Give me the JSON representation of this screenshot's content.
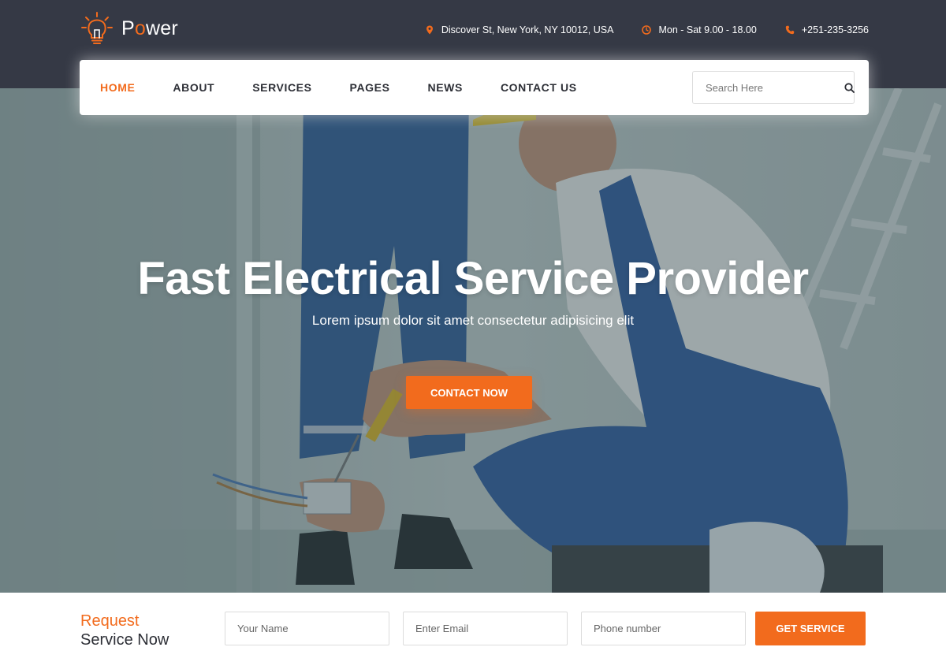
{
  "brand": {
    "logo_text_prefix": "P",
    "logo_text_accent": "o",
    "logo_text_suffix": "wer",
    "icon": "lightbulb-icon",
    "accent_color": "#f26b1d",
    "topbar_color": "#353945"
  },
  "contact": {
    "address": "Discover St, New York, NY 10012, USA",
    "hours": "Mon - Sat 9.00 - 18.00",
    "phone": "+251-235-3256",
    "address_icon": "map-pin-icon",
    "hours_icon": "clock-icon",
    "phone_icon": "phone-icon"
  },
  "nav": {
    "items": [
      {
        "label": "HOME",
        "active": true
      },
      {
        "label": "ABOUT"
      },
      {
        "label": "SERVICES"
      },
      {
        "label": "PAGES"
      },
      {
        "label": "NEWS"
      },
      {
        "label": "CONTACT US"
      }
    ],
    "search_placeholder": "Search Here",
    "search_icon": "search-icon"
  },
  "hero": {
    "title": "Fast Electrical Service Provider",
    "subtitle": "Lorem ipsum dolor sit amet consectetur adipisicing elit",
    "button_label": "CONTACT NOW"
  },
  "request": {
    "title_line1": "Request",
    "title_line2": "Service Now",
    "name_placeholder": "Your Name",
    "email_placeholder": "Enter Email",
    "phone_placeholder": "Phone number",
    "button_label": "GET SERVICE"
  }
}
